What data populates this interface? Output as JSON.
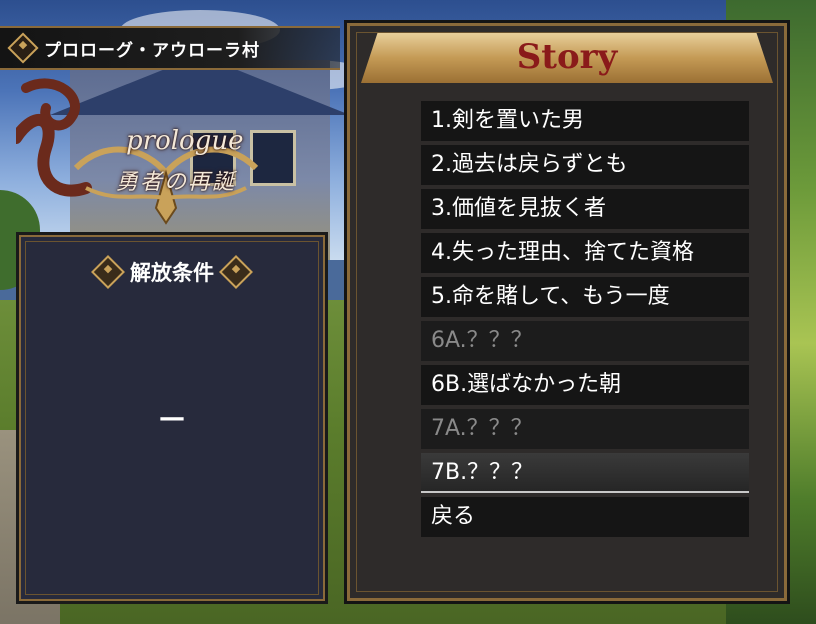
{
  "title_bar": {
    "icon": "diamond-icon",
    "text": "プロローグ・アウローラ村"
  },
  "emblem": {
    "line1": "prologue",
    "line2": "勇者の再誕"
  },
  "unlock_condition": {
    "title": "解放条件",
    "value": "—"
  },
  "story": {
    "title": "Story",
    "items": [
      {
        "label": "1.剣を置いた男",
        "state": "unlocked"
      },
      {
        "label": "2.過去は戻らずとも",
        "state": "unlocked"
      },
      {
        "label": "3.価値を見抜く者",
        "state": "unlocked"
      },
      {
        "label": "4.失った理由、捨てた資格",
        "state": "unlocked"
      },
      {
        "label": "5.命を賭して、もう一度",
        "state": "unlocked"
      },
      {
        "label": "6A.？？？",
        "state": "locked"
      },
      {
        "label": "6B.選ばなかった朝",
        "state": "unlocked"
      },
      {
        "label": "7A.？？？",
        "state": "locked"
      },
      {
        "label": "7B.？？？",
        "state": "selected"
      }
    ],
    "back_label": "戻る"
  },
  "colors": {
    "gold": "#c9a25a",
    "story_title": "#8a1a1a",
    "panel": "#2e2b2a",
    "locked_text": "#8a8a8a"
  }
}
